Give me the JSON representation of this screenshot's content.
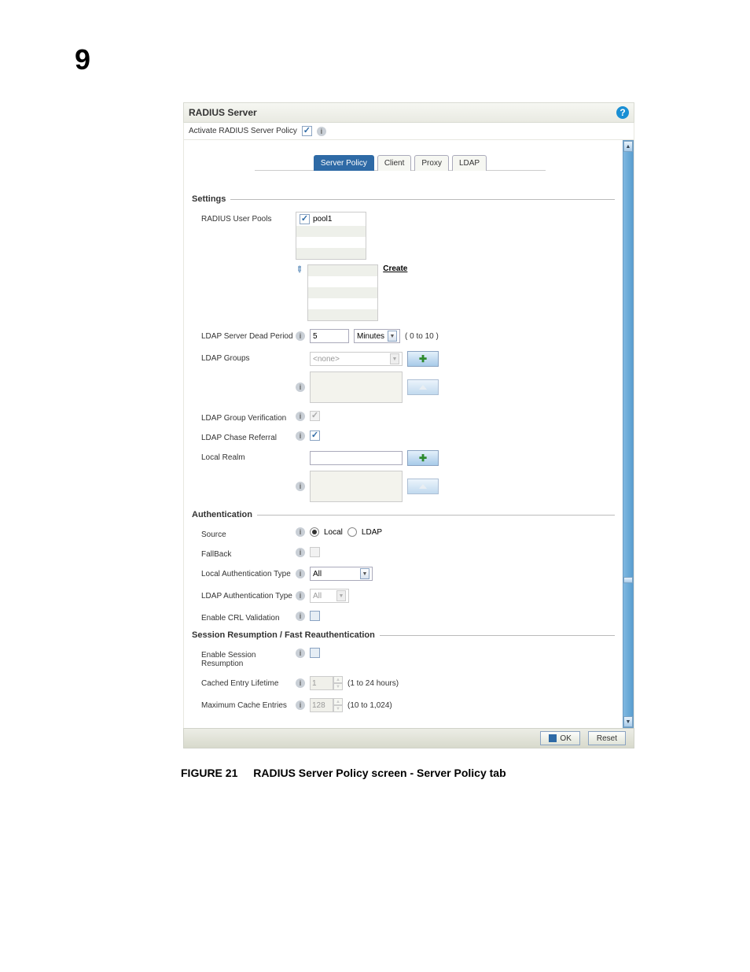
{
  "page_number": "9",
  "titlebar": {
    "title": "RADIUS Server"
  },
  "activate": {
    "label": "Activate RADIUS Server Policy"
  },
  "tabs": [
    "Server Policy",
    "Client",
    "Proxy",
    "LDAP"
  ],
  "active_tab": 0,
  "settings": {
    "header": "Settings",
    "user_pools_label": "RADIUS User Pools",
    "pool_item": "pool1",
    "create_link": "Create",
    "dead_period": {
      "label": "LDAP Server Dead Period",
      "value": "5",
      "unit": "Minutes",
      "range": "( 0 to 10 )"
    },
    "ldap_groups": {
      "label": "LDAP Groups",
      "placeholder": "<none>"
    },
    "group_verify_label": "LDAP Group Verification",
    "chase_referral_label": "LDAP Chase Referral",
    "local_realm_label": "Local Realm"
  },
  "auth": {
    "header": "Authentication",
    "source_label": "Source",
    "source_local": "Local",
    "source_ldap": "LDAP",
    "fallback_label": "FallBack",
    "local_auth_label": "Local Authentication Type",
    "local_auth_value": "All",
    "ldap_auth_label": "LDAP Authentication Type",
    "ldap_auth_value": "All",
    "crl_label": "Enable CRL Validation"
  },
  "session": {
    "header": "Session Resumption / Fast Reauthentication",
    "enable_label": "Enable Session Resumption",
    "cached_label": "Cached Entry Lifetime",
    "cached_value": "1",
    "cached_range": "(1 to 24 hours)",
    "max_label": "Maximum Cache Entries",
    "max_value": "128",
    "max_range": "(10 to 1,024)"
  },
  "footer": {
    "ok": "OK",
    "reset": "Reset"
  },
  "caption": {
    "figure": "FIGURE 21",
    "text": "RADIUS Server Policy screen - Server Policy tab"
  }
}
